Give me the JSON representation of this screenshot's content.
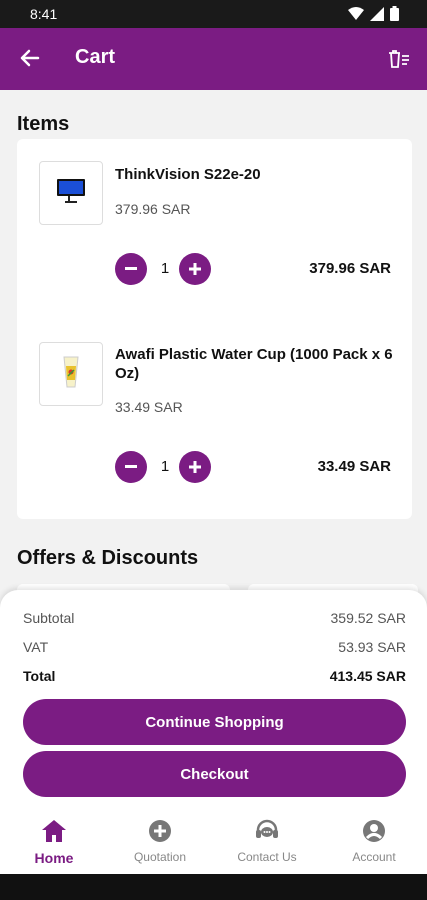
{
  "status_bar": {
    "time": "8:41"
  },
  "app_bar": {
    "title": "Cart"
  },
  "items_section": {
    "title": "Items"
  },
  "items": [
    {
      "name": "ThinkVision S22e-20",
      "unit_price": "379.96 SAR",
      "quantity": "1",
      "line_total": "379.96 SAR",
      "icon": "monitor-icon"
    },
    {
      "name": "Awafi Plastic Water Cup (1000 Pack x 6 Oz)",
      "unit_price": "33.49 SAR",
      "quantity": "1",
      "line_total": "33.49 SAR",
      "icon": "cup-icon"
    }
  ],
  "offers_section": {
    "title": "Offers & Discounts"
  },
  "summary": {
    "subtotal_label": "Subtotal",
    "subtotal_value": "359.52 SAR",
    "vat_label": "VAT",
    "vat_value": "53.93 SAR",
    "total_label": "Total",
    "total_value": "413.45 SAR"
  },
  "buttons": {
    "continue_label": "Continue Shopping",
    "checkout_label": "Checkout"
  },
  "bottom_nav": [
    {
      "label": "Home",
      "icon": "home-icon",
      "active": true
    },
    {
      "label": "Quotation",
      "icon": "add-circle-icon",
      "active": false
    },
    {
      "label": "Contact Us",
      "icon": "support-icon",
      "active": false
    },
    {
      "label": "Account",
      "icon": "account-icon",
      "active": false
    }
  ],
  "colors": {
    "brand": "#7b1c83",
    "background": "#f2f2f2"
  }
}
